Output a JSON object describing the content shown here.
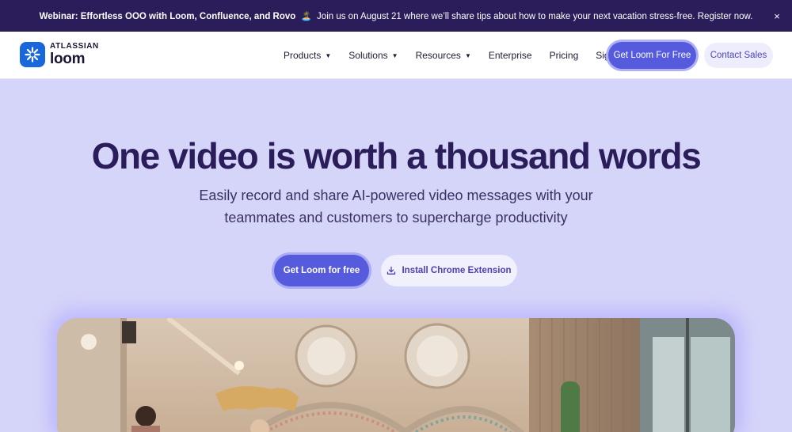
{
  "banner": {
    "bold_text": "Webinar: Effortless OOO with Loom, Confluence, and Rovo",
    "emoji": "🏝️",
    "text": "Join us on August 21 where we’ll share tips about how to make your next vacation stress-free. Register now.",
    "close_icon": "×"
  },
  "logo": {
    "top": "ATLASSIAN",
    "bottom": "loom"
  },
  "nav": {
    "items": [
      {
        "label": "Products",
        "caret": "▼"
      },
      {
        "label": "Solutions",
        "caret": "▼"
      },
      {
        "label": "Resources",
        "caret": "▼"
      },
      {
        "label": "Enterprise"
      },
      {
        "label": "Pricing"
      },
      {
        "label": "Sign In"
      }
    ],
    "primary_button": "Get Loom For Free",
    "secondary_button": "Contact Sales"
  },
  "hero": {
    "title": "One video is worth a thousand words",
    "subtitle_line1": "Easily record and share AI-powered video messages with your",
    "subtitle_line2": "teammates and customers to supercharge productivity",
    "cta_primary": "Get Loom for free",
    "cta_secondary": "Install Chrome Extension"
  },
  "colors": {
    "banner_bg": "#2a1d5a",
    "hero_bg": "#d5d4f9",
    "brand_blue": "#1868db",
    "primary_button": "#565add"
  }
}
